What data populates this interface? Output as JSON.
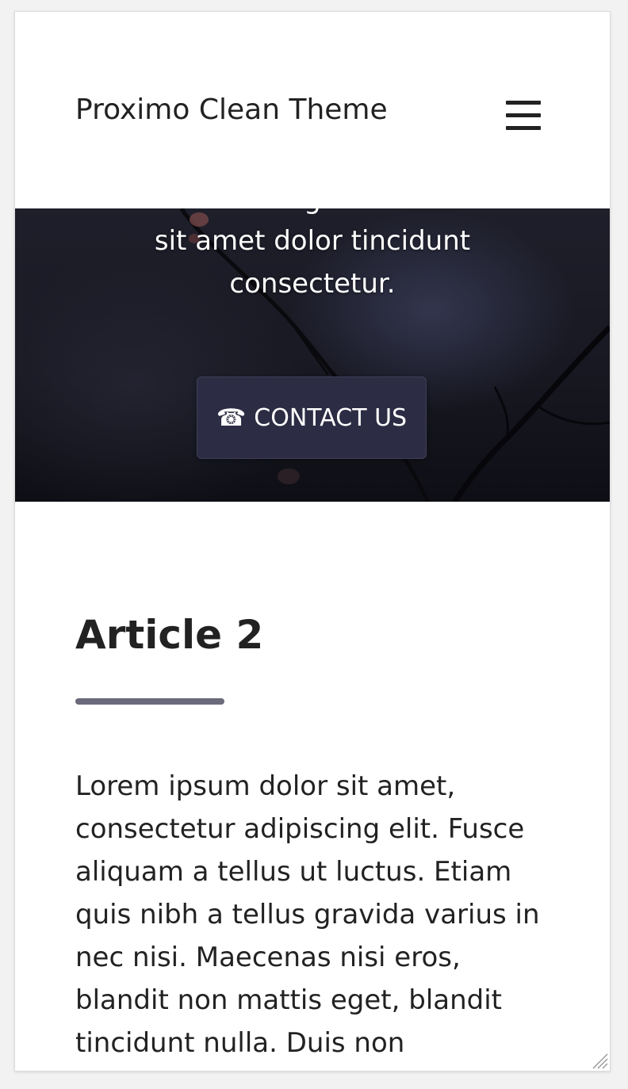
{
  "header": {
    "site_title": "Proximo Clean Theme",
    "menu_icon": "hamburger-menu-icon"
  },
  "hero": {
    "text_partial_top": "g",
    "text_line_1": "sit amet dolor tincidunt",
    "text_line_2": "consectetur.",
    "contact_button": {
      "icon": "☎",
      "label": "CONTACT US"
    }
  },
  "article": {
    "title": "Article 2",
    "body": "Lorem ipsum dolor sit amet, consectetur adipiscing elit. Fusce aliquam a tellus ut luctus. Etiam quis nibh a tellus gravida varius in nec nisi. Maecenas nisi eros, blandit non mattis eget, blandit tincidunt nulla. Duis non"
  },
  "colors": {
    "button_bg": "#2c2c44",
    "underline": "#6a6a7a",
    "text": "#222222"
  }
}
